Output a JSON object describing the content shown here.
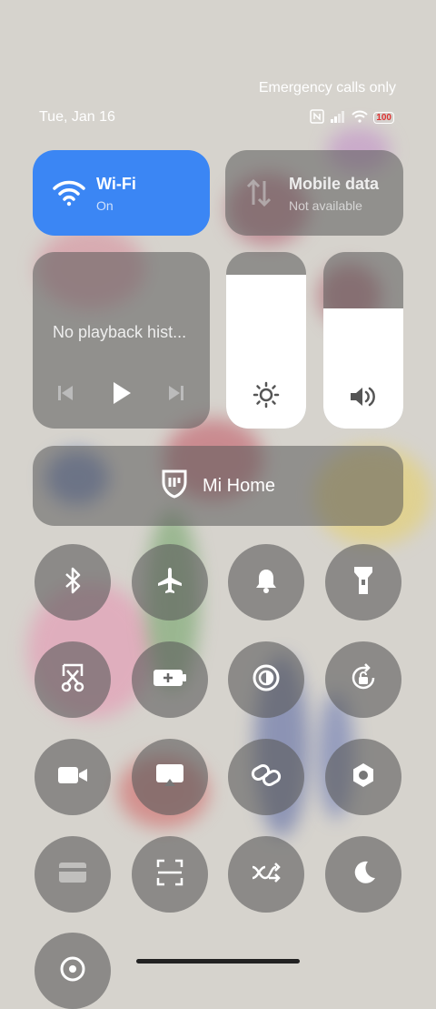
{
  "status_bar": {
    "carrier_text": "Emergency calls only",
    "date": "Tue, Jan 16",
    "battery": "100"
  },
  "tiles": {
    "wifi": {
      "title": "Wi-Fi",
      "subtitle": "On",
      "icon": "wifi-icon"
    },
    "mobile_data": {
      "title": "Mobile data",
      "subtitle": "Not available",
      "icon": "mobile-data-icon"
    }
  },
  "media": {
    "text": "No playback hist..."
  },
  "sliders": {
    "brightness_level": 0.87,
    "volume_level": 0.68
  },
  "mi_home": {
    "label": "Mi Home"
  },
  "toggles": [
    {
      "name": "bluetooth",
      "icon": "bluetooth-icon"
    },
    {
      "name": "airplane-mode",
      "icon": "airplane-icon"
    },
    {
      "name": "ringer",
      "icon": "bell-icon"
    },
    {
      "name": "flashlight",
      "icon": "flashlight-icon"
    },
    {
      "name": "screenshot",
      "icon": "scissors-icon"
    },
    {
      "name": "battery-saver",
      "icon": "battery-plus-icon"
    },
    {
      "name": "contrast",
      "icon": "contrast-icon"
    },
    {
      "name": "auto-rotate",
      "icon": "rotate-lock-icon"
    },
    {
      "name": "video",
      "icon": "video-camera-icon"
    },
    {
      "name": "cast",
      "icon": "cast-icon"
    },
    {
      "name": "link",
      "icon": "link-icon"
    },
    {
      "name": "settings",
      "icon": "hexagon-gear-icon"
    },
    {
      "name": "wallet",
      "icon": "card-icon"
    },
    {
      "name": "scanner",
      "icon": "scan-icon"
    },
    {
      "name": "data-saver",
      "icon": "shuffle-off-icon"
    },
    {
      "name": "dark-mode",
      "icon": "moon-icon"
    },
    {
      "name": "location",
      "icon": "location-icon"
    }
  ],
  "colors": {
    "accent": "#3b86f4"
  }
}
